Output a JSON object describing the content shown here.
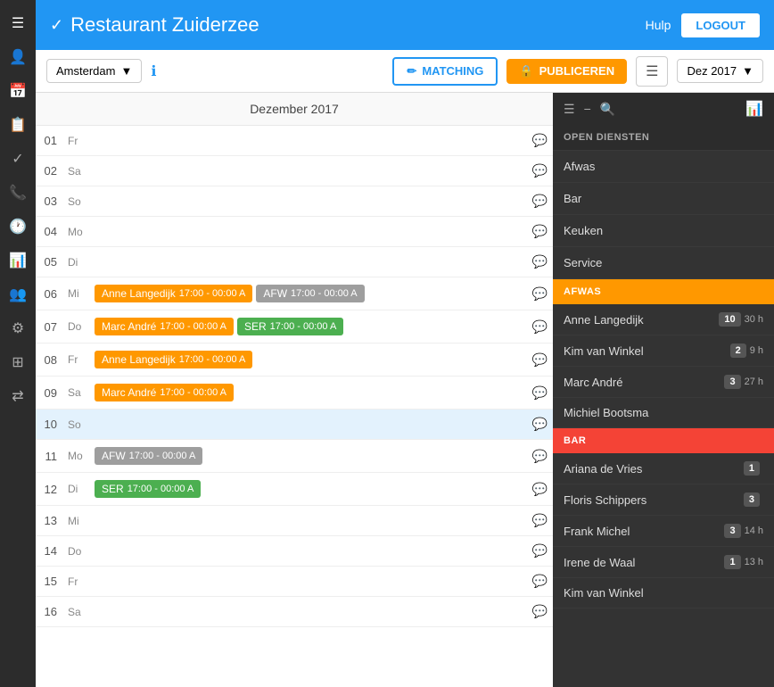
{
  "header": {
    "title": "Restaurant Zuiderzee",
    "chevron": "✓",
    "hulp_label": "Hulp",
    "logout_label": "LOGOUT"
  },
  "toolbar": {
    "location": "Amsterdam",
    "matching_label": "MATCHING",
    "publiceren_label": "PUBLICEREN",
    "month_label": "Dez 2017"
  },
  "calendar": {
    "title": "Dezember 2017",
    "rows": [
      {
        "num": "01",
        "day": "Fr",
        "shifts": [],
        "comment": false
      },
      {
        "num": "02",
        "day": "Sa",
        "shifts": [],
        "comment": false
      },
      {
        "num": "03",
        "day": "So",
        "shifts": [],
        "comment": false
      },
      {
        "num": "04",
        "day": "Mo",
        "shifts": [],
        "comment": false
      },
      {
        "num": "05",
        "day": "Di",
        "shifts": [],
        "comment": false
      },
      {
        "num": "06",
        "day": "Mi",
        "shifts": [
          {
            "name": "Anne Langedijk",
            "time": "17:00 - 00:00",
            "label": "A",
            "color": "orange"
          },
          {
            "name": "AFW",
            "time": "17:00 - 00:00",
            "label": "A",
            "color": "gray"
          }
        ],
        "comment": true
      },
      {
        "num": "07",
        "day": "Do",
        "shifts": [
          {
            "name": "Marc André",
            "time": "17:00 - 00:00",
            "label": "A",
            "color": "orange"
          },
          {
            "name": "SER",
            "time": "17:00 - 00:00",
            "label": "A",
            "color": "green"
          }
        ],
        "comment": false
      },
      {
        "num": "08",
        "day": "Fr",
        "shifts": [
          {
            "name": "Anne Langedijk",
            "time": "17:00 - 00:00",
            "label": "A",
            "color": "orange"
          }
        ],
        "comment": false
      },
      {
        "num": "09",
        "day": "Sa",
        "shifts": [
          {
            "name": "Marc André",
            "time": "17:00 - 00:00",
            "label": "A",
            "color": "orange"
          }
        ],
        "comment": false
      },
      {
        "num": "10",
        "day": "So",
        "shifts": [],
        "comment": false,
        "today": true
      },
      {
        "num": "11",
        "day": "Mo",
        "shifts": [
          {
            "name": "AFW",
            "time": "17:00 - 00:00",
            "label": "A",
            "color": "gray"
          }
        ],
        "comment": false
      },
      {
        "num": "12",
        "day": "Di",
        "shifts": [
          {
            "name": "SER",
            "time": "17:00 - 00:00",
            "label": "A",
            "color": "green"
          }
        ],
        "comment": false
      },
      {
        "num": "13",
        "day": "Mi",
        "shifts": [],
        "comment": false
      },
      {
        "num": "14",
        "day": "Do",
        "shifts": [],
        "comment": false
      },
      {
        "num": "15",
        "day": "Fr",
        "shifts": [],
        "comment": false
      },
      {
        "num": "16",
        "day": "Sa",
        "shifts": [],
        "comment": false
      }
    ]
  },
  "right_panel": {
    "open_diensten_label": "OPEN DIENSTEN",
    "services": [
      {
        "name": "Afwas"
      },
      {
        "name": "Bar"
      },
      {
        "name": "Keuken"
      },
      {
        "name": "Service"
      }
    ],
    "afwas_section": {
      "label": "AFWAS",
      "people": [
        {
          "name": "Anne Langedijk",
          "count": "10",
          "hours": "30 h"
        },
        {
          "name": "Kim van Winkel",
          "count": "2",
          "hours": "9 h"
        },
        {
          "name": "Marc André",
          "count": "3",
          "hours": "27 h"
        },
        {
          "name": "Michiel Bootsma",
          "count": "",
          "hours": ""
        }
      ]
    },
    "bar_section": {
      "label": "BAR",
      "people": [
        {
          "name": "Ariana de Vries",
          "count": "1",
          "hours": ""
        },
        {
          "name": "Floris Schippers",
          "count": "3",
          "hours": ""
        },
        {
          "name": "Frank Michel",
          "count": "3",
          "hours": "14 h"
        },
        {
          "name": "Irene de Waal",
          "count": "1",
          "hours": "13 h"
        },
        {
          "name": "Kim van Winkel",
          "count": "",
          "hours": ""
        }
      ]
    }
  },
  "nav_icons": [
    "☰",
    "👤",
    "📅",
    "📋",
    "✓",
    "📞",
    "🕐",
    "📊",
    "👥",
    "⚙",
    "⊞",
    "⇄"
  ]
}
